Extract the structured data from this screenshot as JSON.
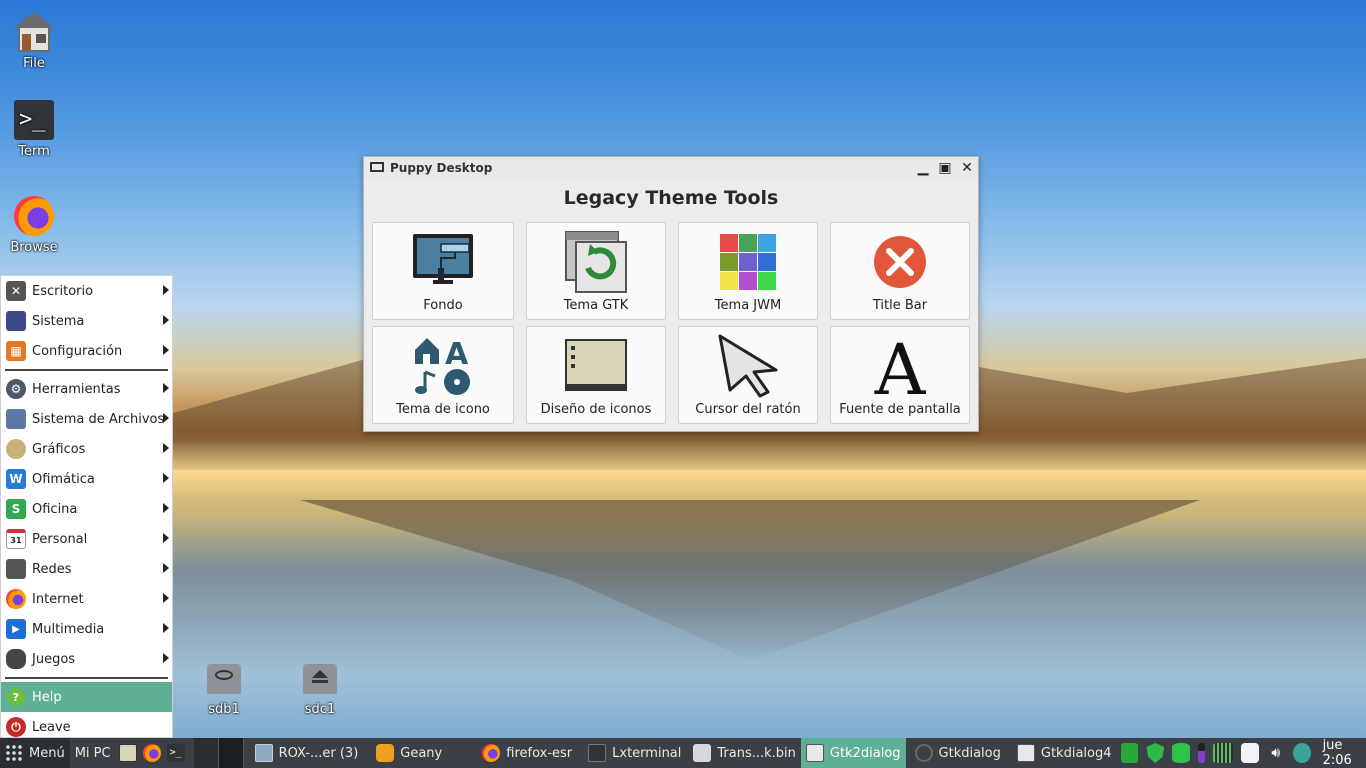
{
  "desktop": {
    "icons": [
      {
        "label": "File",
        "icon": "home-icon"
      },
      {
        "label": "Term",
        "icon": "terminal-icon"
      },
      {
        "label": "Browse",
        "icon": "firefox-icon"
      }
    ],
    "drives": [
      {
        "label": "sdb1",
        "icon": "drive-icon"
      },
      {
        "label": "sdc1",
        "icon": "eject-drive-icon"
      }
    ]
  },
  "start_menu": {
    "items": [
      {
        "label": "Escritorio",
        "icon": "desktop-x-icon",
        "color": "#555555"
      },
      {
        "label": "Sistema",
        "icon": "monitor-icon",
        "color": "#3d4a87"
      },
      {
        "label": "Configuración",
        "icon": "settings-grid-icon",
        "color": "#e07b2a"
      },
      {
        "label": "Herramientas",
        "icon": "gear-icon",
        "color": "#4a5a6a"
      },
      {
        "label": "Sistema de Archivos",
        "icon": "folder-icon",
        "color": "#5b7aa3"
      },
      {
        "label": "Gráficos",
        "icon": "palette-icon",
        "color": "#c9b27a"
      },
      {
        "label": "Ofimática",
        "icon": "writer-icon",
        "color": "#2a7bd6"
      },
      {
        "label": "Oficina",
        "icon": "spreadsheet-icon",
        "color": "#2fa84f"
      },
      {
        "label": "Personal",
        "icon": "calendar-icon",
        "color": "#cc3333"
      },
      {
        "label": "Redes",
        "icon": "network-icon",
        "color": "#555555"
      },
      {
        "label": "Internet",
        "icon": "firefox-icon",
        "color": "#e8641e"
      },
      {
        "label": "Multimedia",
        "icon": "play-icon",
        "color": "#1d6fd6"
      },
      {
        "label": "Juegos",
        "icon": "gamepad-icon",
        "color": "#444444"
      }
    ],
    "help": {
      "label": "Help",
      "icon": "help-icon",
      "color": "#6bbf3a"
    },
    "leave": {
      "label": "Leave",
      "icon": "power-icon",
      "color": "#c62828"
    }
  },
  "window": {
    "title": "Puppy Desktop",
    "heading": "Legacy Theme Tools",
    "tiles": [
      {
        "label": "Fondo",
        "icon": "wallpaper-roller-icon"
      },
      {
        "label": "Tema GTK",
        "icon": "gtk-refresh-icon"
      },
      {
        "label": "Tema JWM",
        "icon": "jwm-color-grid-icon"
      },
      {
        "label": "Title Bar",
        "icon": "close-circle-icon"
      },
      {
        "label": "Tema de icono",
        "icon": "icon-theme-icon"
      },
      {
        "label": "Diseño de iconos",
        "icon": "icon-layout-icon"
      },
      {
        "label": "Cursor del ratón",
        "icon": "mouse-cursor-icon"
      },
      {
        "label": "Fuente de pantalla",
        "icon": "font-a-icon"
      }
    ]
  },
  "taskbar": {
    "menu_label": "Menú",
    "mipc_label": "Mi PC",
    "tasks": [
      {
        "label": "ROX-...er (3)",
        "icon": "rox-filer-icon",
        "active": false
      },
      {
        "label": "Geany",
        "icon": "geany-icon",
        "active": false
      },
      {
        "label": "firefox-esr",
        "icon": "firefox-icon",
        "active": false
      },
      {
        "label": "Lxterminal",
        "icon": "terminal-icon",
        "active": false
      },
      {
        "label": "Trans...k.bin",
        "icon": "transmission-icon",
        "active": false
      },
      {
        "label": "Gtk2dialog",
        "icon": "window-icon",
        "active": true
      },
      {
        "label": "Gtkdialog",
        "icon": "refresh-icon",
        "active": false
      },
      {
        "label": "Gtkdialog4",
        "icon": "window-icon",
        "active": false
      }
    ],
    "clock": "jue  2:06"
  }
}
